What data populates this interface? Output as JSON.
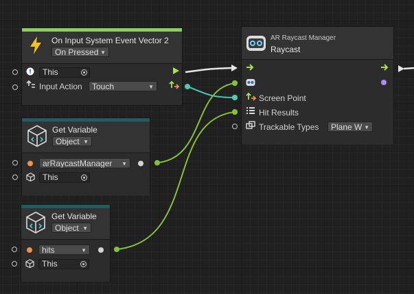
{
  "colors": {
    "event_accent": "#8acf56",
    "variable_accent": "#1f5d5f",
    "control_wire": "#e6e6e6",
    "vector_wire": "#4fc9b4",
    "object_wire": "#83c23a",
    "object_port": "#f0914a",
    "flow_arrow": "#a7e34f",
    "purple_port": "#a98cf0"
  },
  "event_node": {
    "title": "On Input System Event Vector 2",
    "mode": "On Pressed",
    "target": "This",
    "input_action_label": "Input Action",
    "input_action_value": "Touch",
    "icon": "lightning-bolt-icon"
  },
  "var_node_1": {
    "title": "Get Variable",
    "kind": "Object",
    "name": "arRaycastManager",
    "target": "This",
    "icon": "cube-variable-icon"
  },
  "var_node_2": {
    "title": "Get Variable",
    "kind": "Object",
    "name": "hits",
    "target": "This",
    "icon": "cube-variable-icon"
  },
  "raycast_node": {
    "subtitle": "AR Raycast Manager",
    "title": "Raycast",
    "screen_point_label": "Screen Point",
    "hit_results_label": "Hit Results",
    "trackable_types_label": "Trackable Types",
    "trackable_types_value": "Plane W",
    "icon": "ar-goggles-icon"
  }
}
